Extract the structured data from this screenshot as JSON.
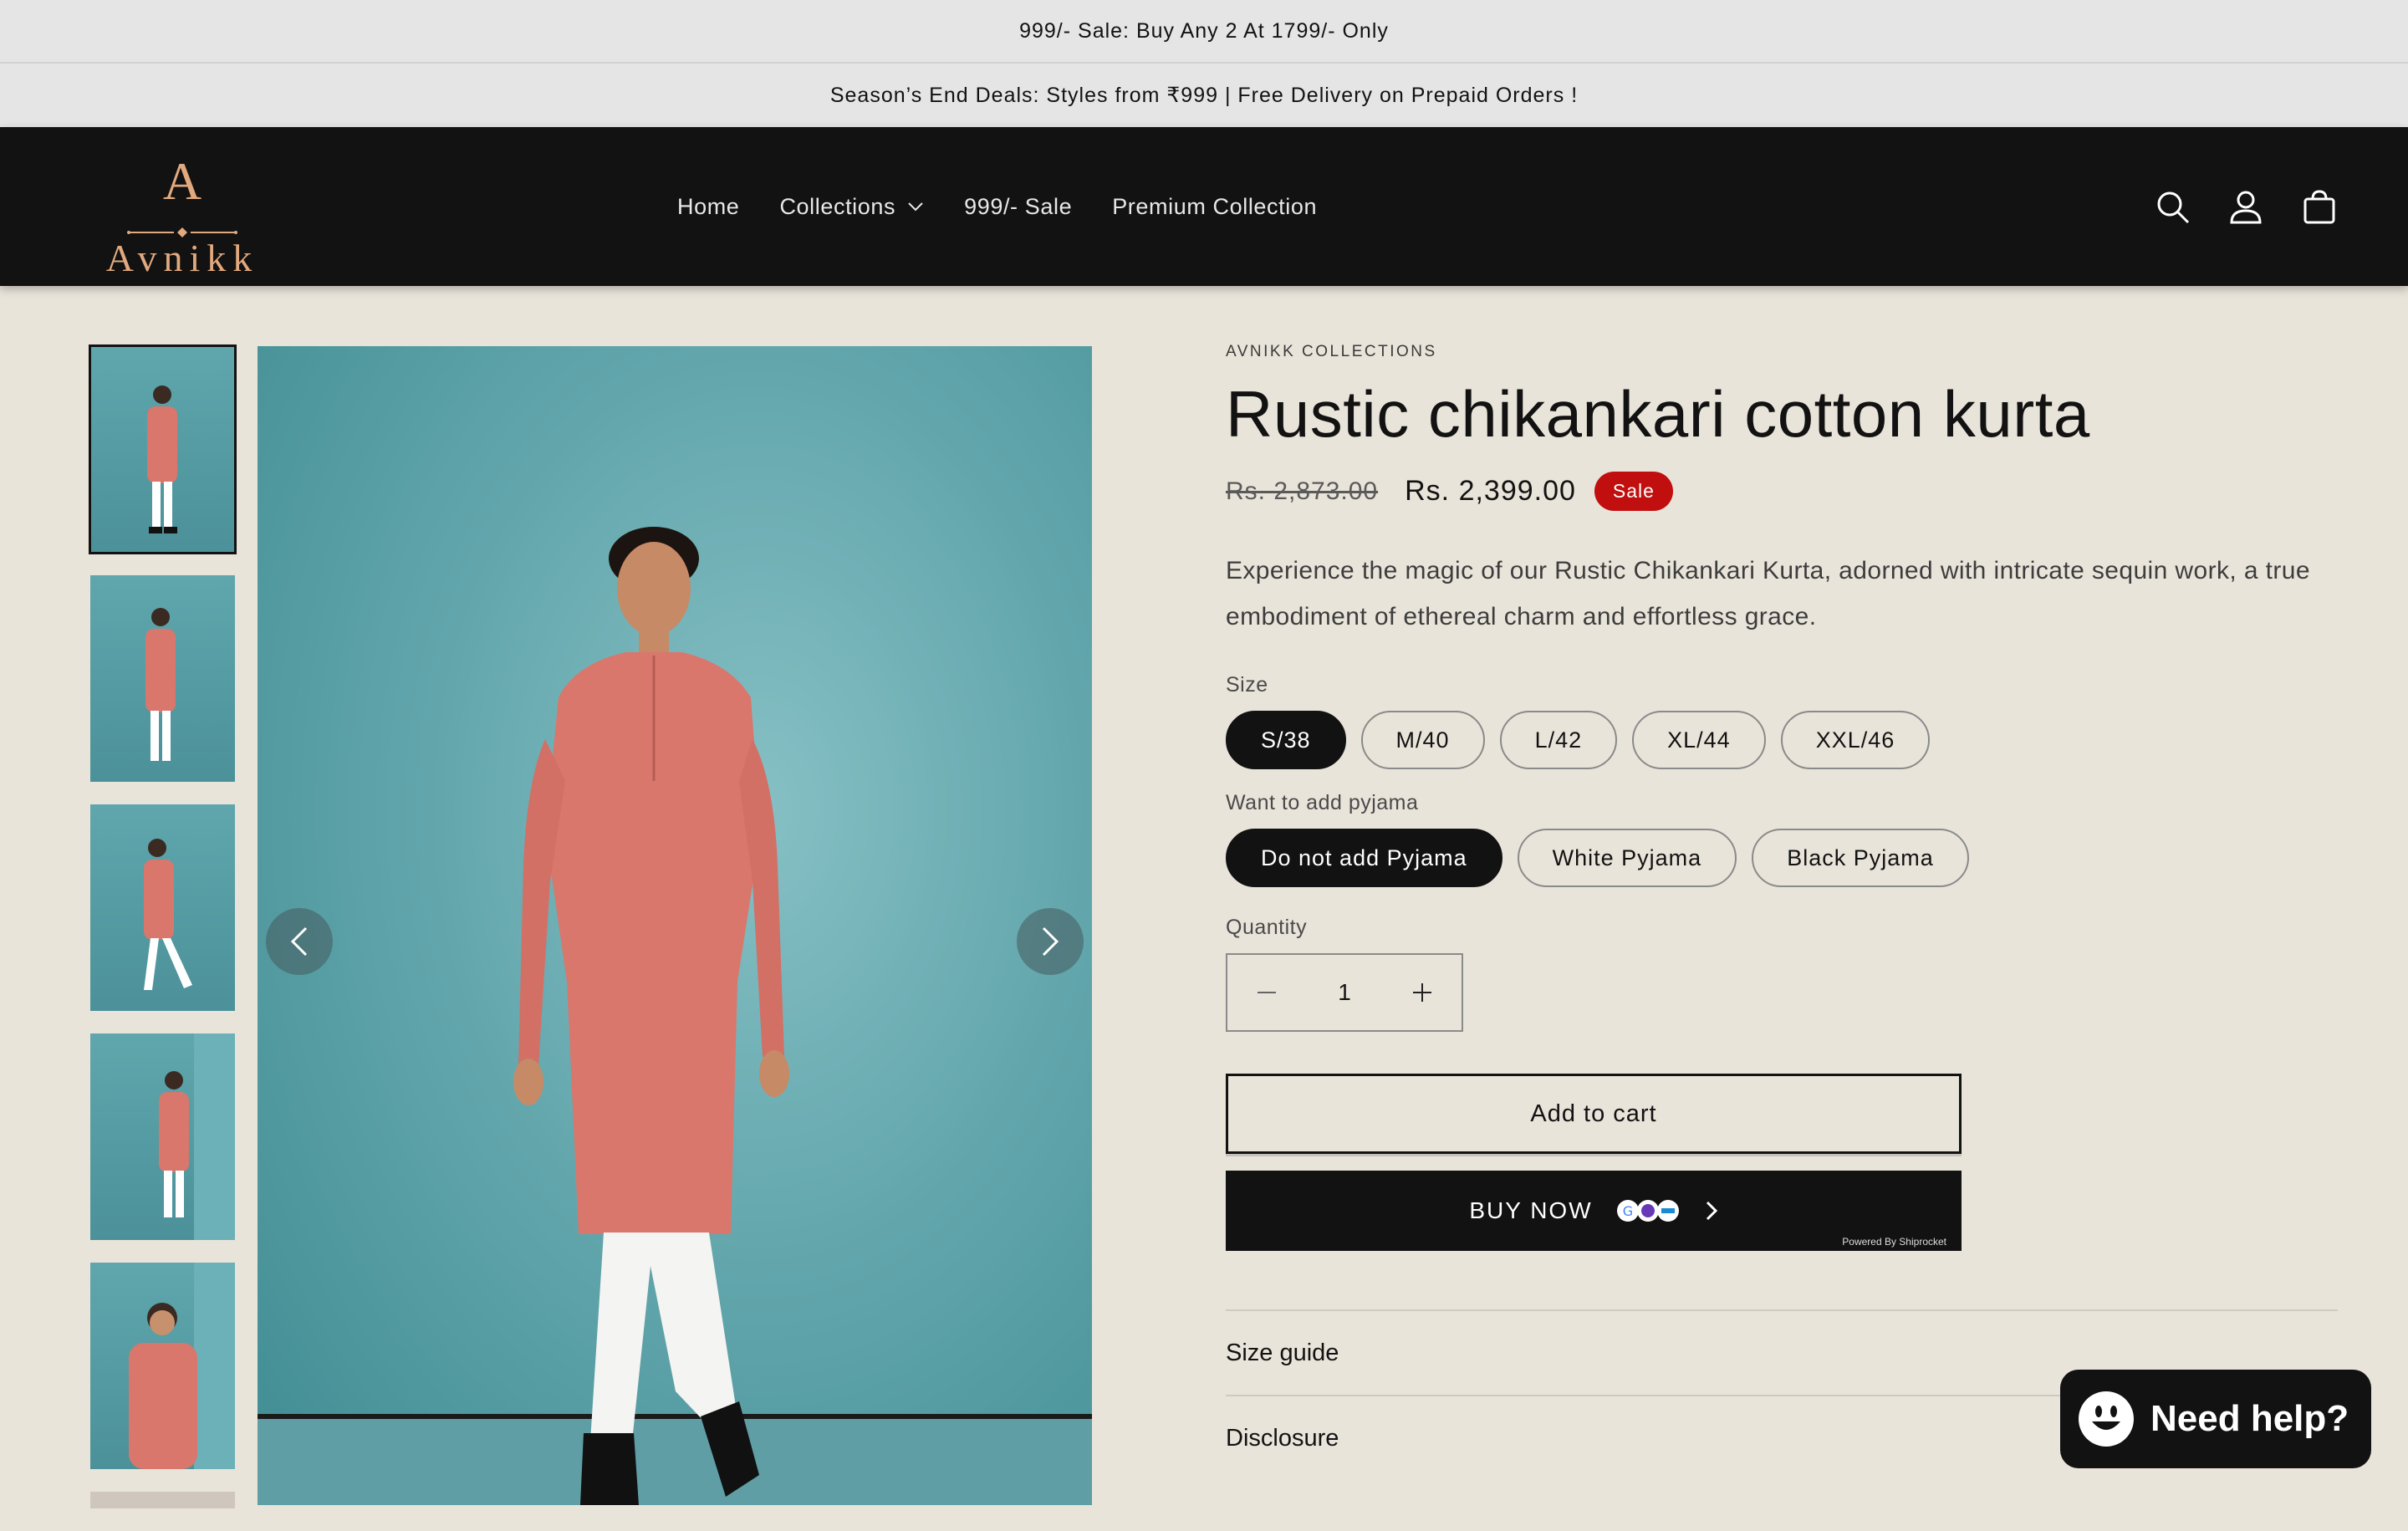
{
  "announcements": [
    "999/- Sale: Buy Any 2 At 1799/- Only",
    "Season’s End Deals: Styles from ₹999 | Free Delivery on Prepaid Orders !"
  ],
  "header": {
    "logo_letter": "A",
    "logo_text": "Avnikk",
    "nav": [
      "Home",
      "Collections",
      "999/- Sale",
      "Premium Collection"
    ],
    "icons": [
      "search-icon",
      "account-icon",
      "cart-icon"
    ]
  },
  "gallery": {
    "thumbnail_count": 5,
    "active_index": 0
  },
  "product": {
    "vendor": "AVNIKK COLLECTIONS",
    "title": "Rustic chikankari cotton kurta",
    "compare_price": "Rs. 2,873.00",
    "price": "Rs. 2,399.00",
    "badge": "Sale",
    "description": "Experience the magic of our Rustic Chikankari Kurta, adorned with intricate sequin work, a true embodiment of ethereal charm and effortless grace.",
    "size_label": "Size",
    "sizes": [
      "S/38",
      "M/40",
      "L/42",
      "XL/44",
      "XXL/46"
    ],
    "selected_size": "S/38",
    "pyjama_label": "Want to add pyjama",
    "pyjama_options": [
      "Do not add Pyjama",
      "White Pyjama",
      "Black Pyjama"
    ],
    "selected_pyjama": "Do not add Pyjama",
    "quantity_label": "Quantity",
    "quantity": "1",
    "add_to_cart": "Add to cart",
    "buy_now": "BUY NOW",
    "powered_by": "Powered By Shiprocket",
    "accordion": [
      "Size guide",
      "Disclosure"
    ]
  },
  "chat": {
    "label": "Need help?"
  },
  "colors": {
    "page_bg": "#e9e4da",
    "header_bg": "#121212",
    "logo": "#e2a97e",
    "sale_badge": "#c10e0e",
    "product_bg": "#5fa6ad",
    "kurta": "#d9776c"
  }
}
